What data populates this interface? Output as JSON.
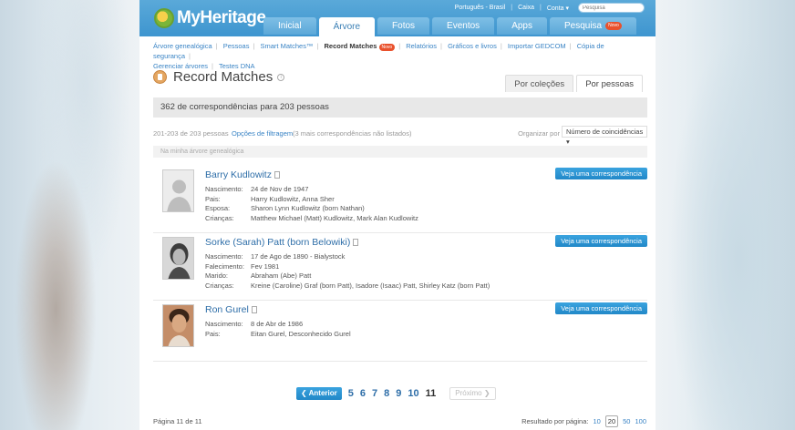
{
  "header": {
    "logo": "MyHeritage",
    "top_links": [
      "Português - Brasil",
      "Caixa",
      "Conta ▾"
    ],
    "search_placeholder": "Pesquisa",
    "nav": [
      {
        "label": "Inicial"
      },
      {
        "label": "Árvore"
      },
      {
        "label": "Fotos"
      },
      {
        "label": "Eventos"
      },
      {
        "label": "Apps"
      },
      {
        "label": "Pesquisa",
        "badge": "Novo"
      }
    ]
  },
  "subnav": {
    "items": [
      "Árvore genealógica",
      "Pessoas",
      "Smart Matches™",
      "Record Matches",
      "Relatórios",
      "Gráficos e livros",
      "Importar GEDCOM",
      "Cópia de segurança",
      "Gerenciar árvores",
      "Testes DNA"
    ],
    "active_badge": "Novo"
  },
  "page": {
    "title": "Record Matches",
    "view_tabs": [
      "Por coleções",
      "Por pessoas"
    ],
    "summary": "362 de correspondências para 203 pessoas",
    "range": "201-203 de 203 pessoas",
    "filter_link": "Opções de filtragem",
    "hidden_note": "(3 mais correspondências não listados)",
    "sort_label": "Organizar por",
    "sort_value": "Número de coincidências ▾",
    "group_header": "Na minha árvore genealógica",
    "match_button": "Veja uma correspondência"
  },
  "records": [
    {
      "name": "Barry Kudlowitz",
      "facts": [
        {
          "label": "Nascimento:",
          "value": "24 de Nov de 1947"
        },
        {
          "label": "Pais:",
          "value": "Harry Kudlowitz, Anna Sher"
        },
        {
          "label": "Esposa:",
          "value": "Sharon Lynn Kudlowitz (born Nathan)"
        },
        {
          "label": "Crianças:",
          "value": "Matthew Michael (Matt) Kudlowitz, Mark Alan Kudlowitz"
        }
      ]
    },
    {
      "name": "Sorke (Sarah) Patt (born Belowiki)",
      "facts": [
        {
          "label": "Nascimento:",
          "value": "17 de Ago de 1890 - Bialystock"
        },
        {
          "label": "Falecimento:",
          "value": "Fev 1981"
        },
        {
          "label": "Marido:",
          "value": "Abraham (Abe) Patt"
        },
        {
          "label": "Crianças:",
          "value": "Kreine (Caroline) Graf (born Patt), Isadore (Isaac) Patt, Shirley Katz (born Patt)"
        }
      ]
    },
    {
      "name": "Ron Gurel",
      "facts": [
        {
          "label": "Nascimento:",
          "value": "8 de Abr de 1986"
        },
        {
          "label": "Pais:",
          "value": "Eitan Gurel, Desconhecido Gurel"
        }
      ]
    }
  ],
  "pager": {
    "prev": "❮ Anterior",
    "pages": [
      "5",
      "6",
      "7",
      "8",
      "9",
      "10",
      "11"
    ],
    "current": "11",
    "next": "Próximo ❯",
    "page_info": "Página 11 de 11",
    "per_page_label": "Resultado por página:",
    "per_page_options": [
      "10",
      "20",
      "50",
      "100"
    ],
    "per_page_selected": "20"
  }
}
